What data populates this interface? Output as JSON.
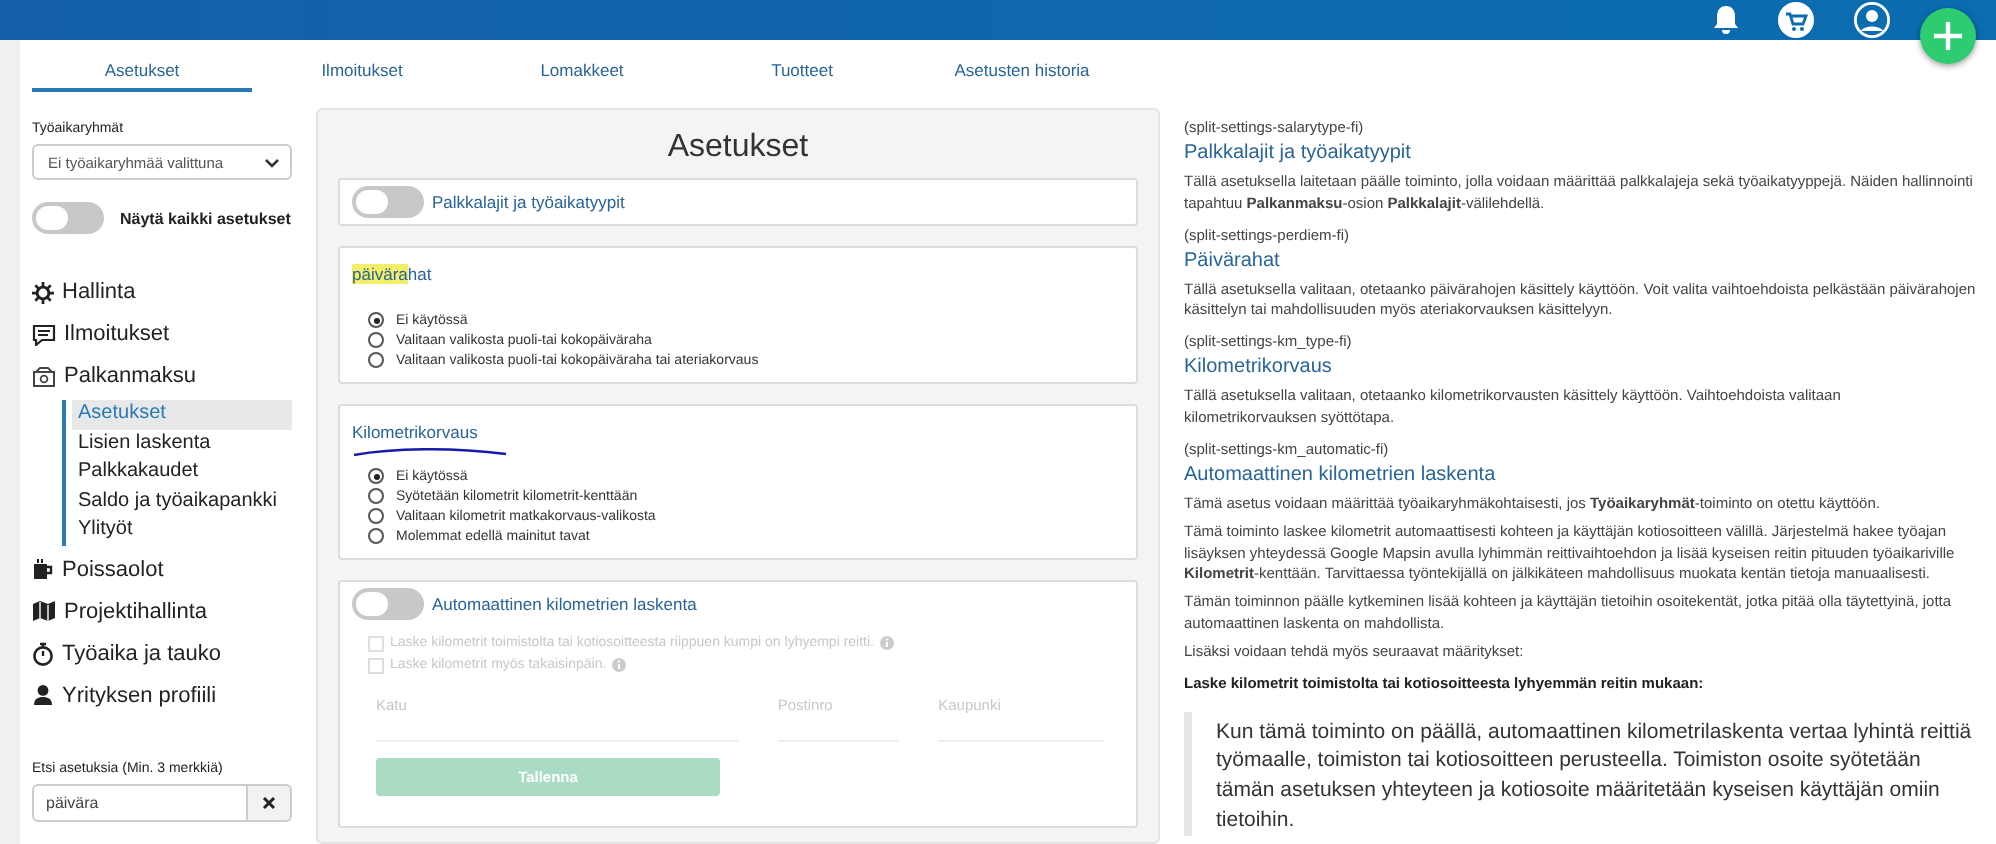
{
  "tabs": [
    {
      "label": "Asetukset",
      "selected": true
    },
    {
      "label": "Ilmoitukset",
      "selected": false
    },
    {
      "label": "Lomakkeet",
      "selected": false
    },
    {
      "label": "Tuotteet",
      "selected": false
    },
    {
      "label": "Asetusten historia",
      "selected": false
    }
  ],
  "sidebar": {
    "group_label": "Työaikaryhmät",
    "group_select": "Ei työaikaryhmää valittuna",
    "show_all": {
      "label": "Näytä kaikki asetukset",
      "on": false
    },
    "nav": [
      {
        "label": "Hallinta"
      },
      {
        "label": "Ilmoitukset"
      },
      {
        "label": "Palkanmaksu",
        "children": [
          {
            "label": "Asetukset",
            "selected": true
          },
          {
            "label": "Lisien laskenta",
            "selected": false
          },
          {
            "label": "Palkkakaudet",
            "selected": false
          },
          {
            "label": "Saldo ja työaikapankki",
            "selected": false
          },
          {
            "label": "Ylityöt",
            "selected": false
          }
        ]
      },
      {
        "label": "Poissaolot"
      },
      {
        "label": "Projektihallinta"
      },
      {
        "label": "Työaika ja tauko"
      },
      {
        "label": "Yrityksen profiili"
      }
    ],
    "search": {
      "label": "Etsi asetuksia (Min. 3 merkkiä)",
      "value": "päivära"
    }
  },
  "panel": {
    "title": "Asetukset",
    "sections": [
      {
        "kind": "toggle",
        "title": "Palkkalajit ja työaikatyypit",
        "on": false
      },
      {
        "kind": "radio",
        "title_parts": [
          {
            "text": "päivära",
            "highlighted": true
          },
          {
            "text": "hat",
            "highlighted": false
          }
        ],
        "pen_underline": false,
        "options": [
          {
            "label": "Ei käytössä",
            "selected": true
          },
          {
            "label": "Valitaan valikosta puoli-tai kokopäiväraha",
            "selected": false
          },
          {
            "label": "Valitaan valikosta puoli-tai kokopäiväraha tai ateriakorvaus",
            "selected": false
          }
        ]
      },
      {
        "kind": "radio",
        "title_parts": [
          {
            "text": "Kilometrikorvaus",
            "highlighted": false
          }
        ],
        "pen_underline": true,
        "options": [
          {
            "label": "Ei käytössä",
            "selected": true
          },
          {
            "label": "Syötetään kilometrit kilometrit-kenttään",
            "selected": false
          },
          {
            "label": "Valitaan kilometrit matkakorvaus-valikosta",
            "selected": false
          },
          {
            "label": "Molemmat edellä mainitut tavat",
            "selected": false
          }
        ]
      },
      {
        "kind": "address",
        "title": "Automaattinen kilometrien laskenta",
        "on": false,
        "disabled": true,
        "checks": [
          {
            "label": "Laske kilometrit toimistolta tai kotiosoitteesta riippuen kumpi on lyhyempi reitti.",
            "checked": false
          },
          {
            "label": "Laske kilometrit myös takaisinpäin.",
            "checked": false
          }
        ],
        "fields": [
          {
            "placeholder": "Katu"
          },
          {
            "placeholder": "Postinro"
          },
          {
            "placeholder": "Kaupunki"
          }
        ],
        "button": "Tallenna"
      }
    ]
  },
  "help": [
    {
      "key": "(split-settings-salarytype-fi)",
      "title": "Palkkalajit ja työaikatyypit",
      "paragraphs": [
        {
          "kind": "text",
          "text": "Tällä asetuksella laitetaan päälle toiminto, jolla voidaan määrittää palkkalajeja sekä työaikatyyppejä. Näiden hallinnointi tapahtuu **Palkanmaksu**-osion **Palkkalajit**-välilehdellä."
        }
      ]
    },
    {
      "key": "(split-settings-perdiem-fi)",
      "title": "Päivärahat",
      "paragraphs": [
        {
          "kind": "text",
          "text": "Tällä asetuksella valitaan, otetaanko päivärahojen käsittely käyttöön. Voit valita vaihtoehdoista pelkästään päivärahojen käsittelyn tai mahdollisuuden myös ateriakorvauksen käsittelyyn."
        }
      ]
    },
    {
      "key": "(split-settings-km_type-fi)",
      "title": "Kilometrikorvaus",
      "paragraphs": [
        {
          "kind": "text",
          "text": "Tällä asetuksella valitaan, otetaanko kilometrikorvausten käsittely käyttöön. Vaihtoehdoista valitaan kilometrikorvauksen syöttötapa."
        }
      ]
    },
    {
      "key": "(split-settings-km_automatic-fi)",
      "title": "Automaattinen kilometrien laskenta",
      "paragraphs": [
        {
          "kind": "text",
          "text": "Tämä asetus voidaan määrittää työaikaryhmäkohtaisesti, jos **Työaikaryhmät**-toiminto on otettu käyttöön."
        },
        {
          "kind": "text",
          "text": "Tämä toiminto laskee kilometrit automaattisesti kohteen ja käyttäjän kotiosoitteen välillä. Järjestelmä hakee työajan lisäyksen yhteydessä Google Mapsin avulla lyhimmän reittivaihtoehdon ja lisää kyseisen reitin pituuden työaikariville **Kilometrit**-kenttään. Tarvittaessa työntekijällä on jälkikäteen mahdollisuus muokata kentän tietoja manuaalisesti."
        },
        {
          "kind": "text",
          "text": "Tämän toiminnon päälle kytkeminen lisää kohteen ja käyttäjän tietoihin osoitekentät, jotka pitää olla täytettyinä, jotta automaattinen laskenta on mahdollista."
        },
        {
          "kind": "text",
          "text": "Lisäksi voidaan tehdä myös seuraavat määritykset:"
        },
        {
          "kind": "strong",
          "text": "Laske kilometrit toimistolta tai kotiosoitteesta lyhyemmän reitin mukaan:"
        },
        {
          "kind": "quote",
          "text": "Kun tämä toiminto on päällä, automaattinen kilometrilaskenta vertaa lyhintä reittiä työmaalle, toimiston tai kotiosoitteen perusteella. Toimiston osoite syötetään tämän asetuksen yhteyteen ja kotiosoite määritetään kyseisen käyttäjän omiin tietoihin."
        }
      ]
    }
  ]
}
